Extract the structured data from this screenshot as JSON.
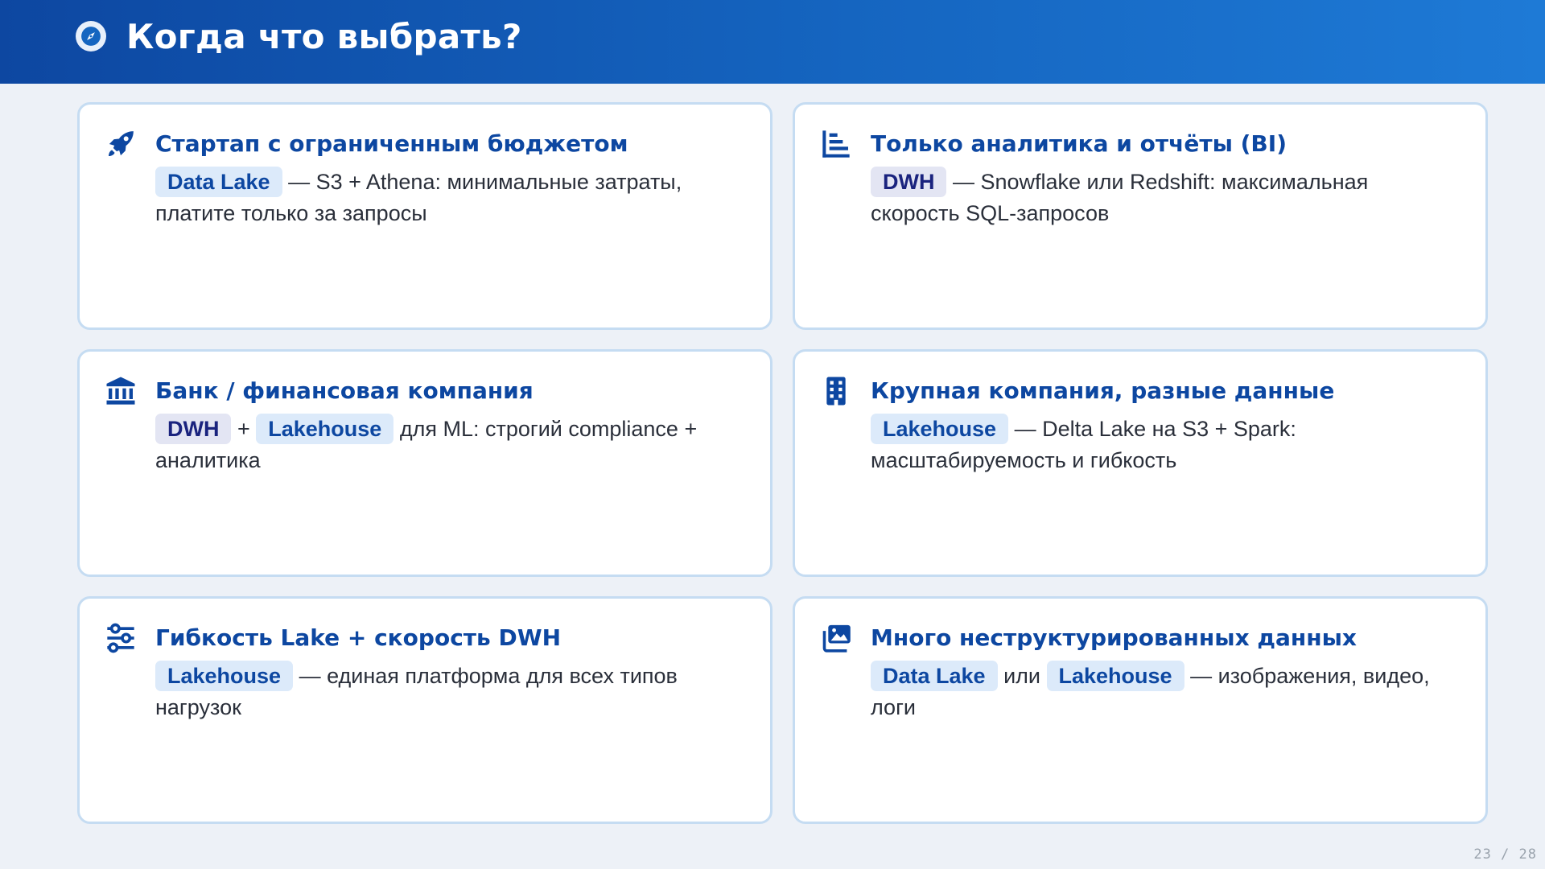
{
  "header": {
    "title": "Когда что выбрать?",
    "icon": "compass-icon"
  },
  "colors": {
    "primary": "#0d47a1",
    "header_gradient_end": "#1e7ad6",
    "card_border": "#c5dcf2",
    "tag_bg": "#dceafa",
    "tag_dwh_bg": "#e3e5f3"
  },
  "cards": [
    {
      "icon": "rocket-icon",
      "title": "Стартап с ограниченным бюджетом",
      "tag1": "Data Lake",
      "text": " — S3 + Athena: минимальные затраты, платите только за запросы"
    },
    {
      "icon": "bar-chart-icon",
      "title": "Только аналитика и отчёты (BI)",
      "tag1": "DWH",
      "text": " — Snowflake или Redshift: максимальная скорость SQL-запросов"
    },
    {
      "icon": "bank-icon",
      "title": "Банк / финансовая компания",
      "tag1": "DWH",
      "sep": " + ",
      "tag2": "Lakehouse",
      "text": " для ML: строгий compliance + аналитика"
    },
    {
      "icon": "building-icon",
      "title": "Крупная компания, разные данные",
      "tag1": "Lakehouse",
      "text": " — Delta Lake на S3 + Spark: масштабируемость и гибкость"
    },
    {
      "icon": "sliders-icon",
      "title": "Гибкость Lake + скорость DWH",
      "tag1": "Lakehouse",
      "text": " — единая платформа для всех типов нагрузок"
    },
    {
      "icon": "images-icon",
      "title": "Много неструктурированных данных",
      "tag1": "Data Lake",
      "sep": " или ",
      "tag2": "Lakehouse",
      "text": " — изображения, видео, логи"
    }
  ],
  "footer": {
    "page": "23 / 28"
  }
}
